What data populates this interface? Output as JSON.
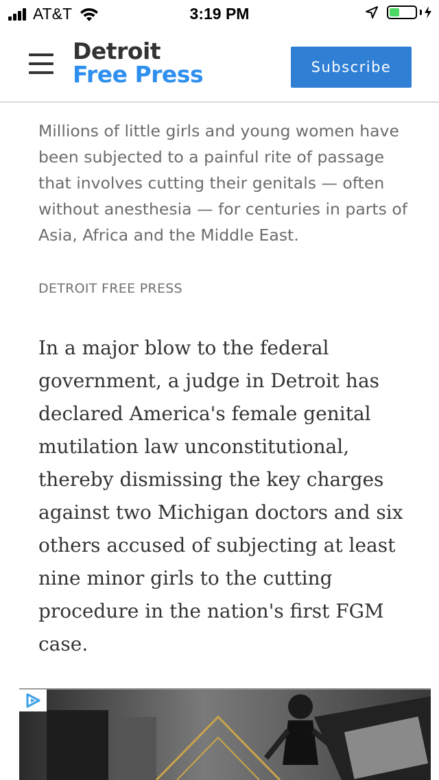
{
  "status_bar": {
    "carrier": "AT&T",
    "time": "3:19 PM",
    "battery_level": 0.4,
    "colors": {
      "battery": "#4cd964"
    }
  },
  "header": {
    "logo_line1": "Detroit",
    "logo_line2": "Free Press",
    "subscribe_label": "Subscribe",
    "colors": {
      "logo_accent": "#2f8fee",
      "subscribe_bg": "#2f7fd4"
    },
    "icons": [
      "menu-icon"
    ]
  },
  "caption": {
    "text": "Millions of little girls and young women have been subjected to a painful rite of passage that involves cutting their genitals — often without anesthesia — for centuries in parts of Asia, Africa and the Middle East.",
    "credit": "DETROIT FREE PRESS"
  },
  "article": {
    "paragraph": "In a major blow to the federal government, a judge in Detroit has declared America's female genital mutilation law unconstitutional, thereby dismissing the key charges against two Michigan doctors and six others accused of subjecting at least nine minor girls to the cutting procedure in the nation's first FGM case."
  },
  "ad": {
    "icons": [
      "ad-choices-icon"
    ]
  }
}
